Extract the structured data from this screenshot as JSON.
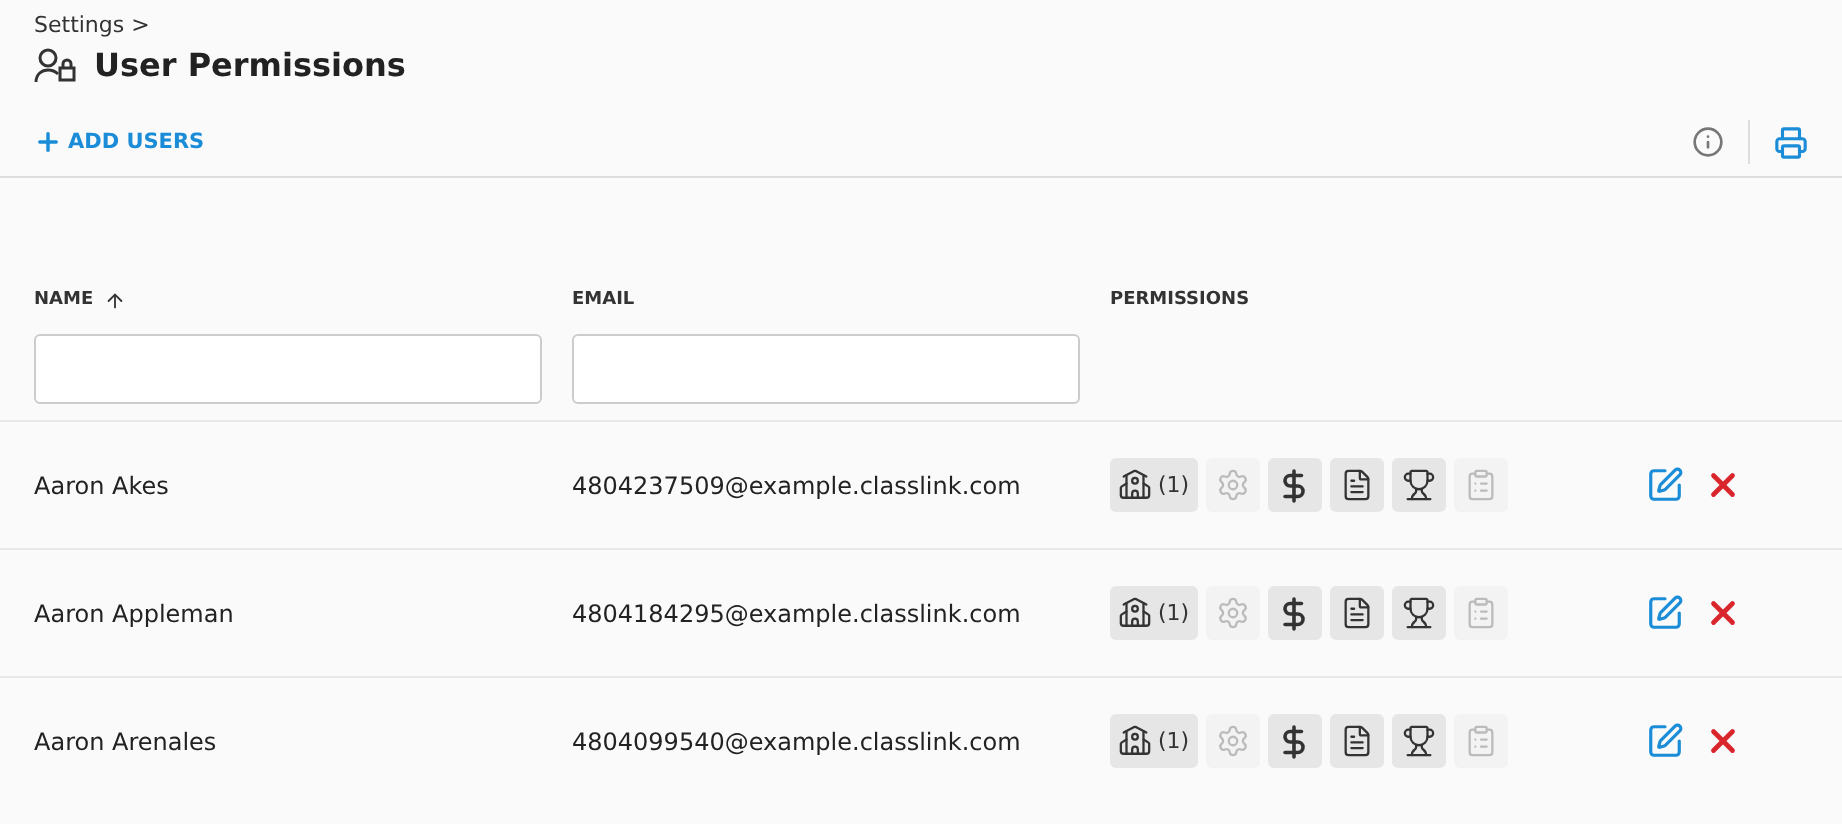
{
  "breadcrumb": "Settings >",
  "title": "User Permissions",
  "add_button": "ADD USERS",
  "table": {
    "columns": [
      {
        "label": "NAME",
        "sorted": true
      },
      {
        "label": "EMAIL",
        "sorted": false
      },
      {
        "label": "PERMISSIONS",
        "sorted": false
      }
    ],
    "rows": [
      {
        "name": "Aaron Akes",
        "email": "4804237509@example.classlink.com",
        "permissions": [
          {
            "kind": "school",
            "enabled": true,
            "count": "(1)"
          },
          {
            "kind": "settings",
            "enabled": false
          },
          {
            "kind": "dollar",
            "enabled": true
          },
          {
            "kind": "invoice",
            "enabled": true
          },
          {
            "kind": "trophy",
            "enabled": true
          },
          {
            "kind": "clipboard",
            "enabled": false
          }
        ]
      },
      {
        "name": "Aaron Appleman",
        "email": "4804184295@example.classlink.com",
        "permissions": [
          {
            "kind": "school",
            "enabled": true,
            "count": "(1)"
          },
          {
            "kind": "settings",
            "enabled": false
          },
          {
            "kind": "dollar",
            "enabled": true
          },
          {
            "kind": "invoice",
            "enabled": true
          },
          {
            "kind": "trophy",
            "enabled": true
          },
          {
            "kind": "clipboard",
            "enabled": false
          }
        ]
      },
      {
        "name": "Aaron Arenales",
        "email": "4804099540@example.classlink.com",
        "permissions": [
          {
            "kind": "school",
            "enabled": true,
            "count": "(1)"
          },
          {
            "kind": "settings",
            "enabled": false
          },
          {
            "kind": "dollar",
            "enabled": true
          },
          {
            "kind": "invoice",
            "enabled": true
          },
          {
            "kind": "trophy",
            "enabled": true
          },
          {
            "kind": "clipboard",
            "enabled": false
          }
        ]
      }
    ]
  }
}
